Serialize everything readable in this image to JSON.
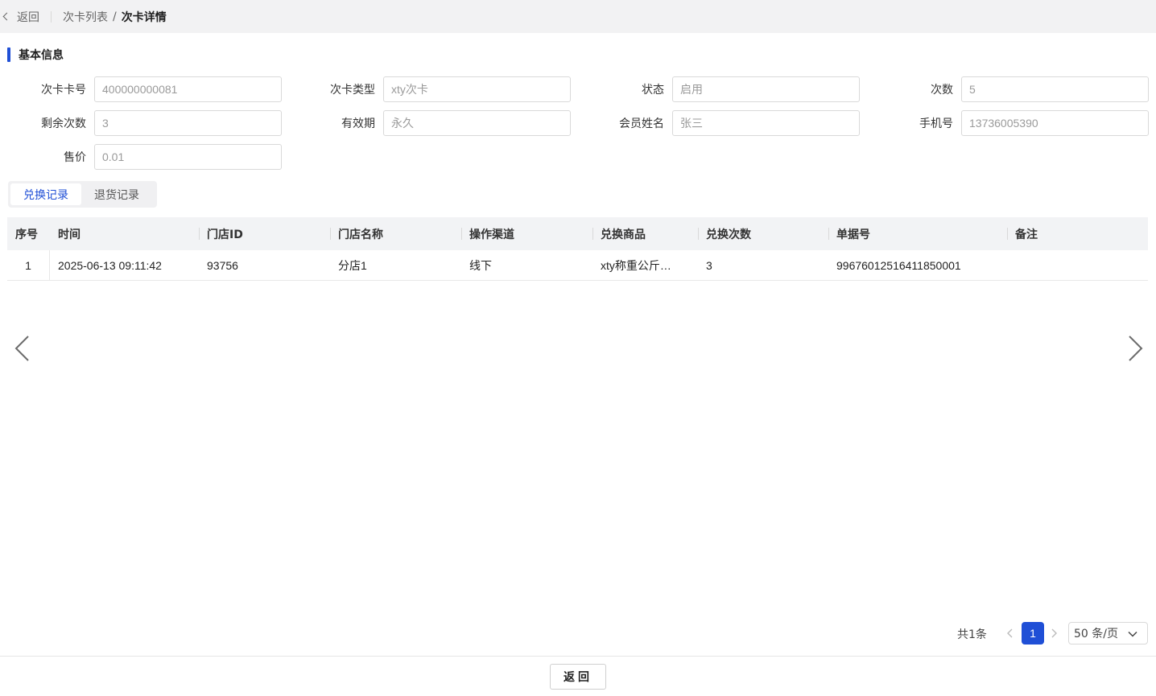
{
  "breadcrumb": {
    "back_label": "返回",
    "items": [
      "次卡列表",
      "次卡详情"
    ],
    "separator": "/"
  },
  "section": {
    "title": "基本信息"
  },
  "fields": [
    {
      "label": "次卡卡号",
      "value": "400000000081"
    },
    {
      "label": "次卡类型",
      "value": "xty次卡"
    },
    {
      "label": "状态",
      "value": "启用"
    },
    {
      "label": "次数",
      "value": "5"
    },
    {
      "label": "剩余次数",
      "value": "3"
    },
    {
      "label": "有效期",
      "value": "永久"
    },
    {
      "label": "会员姓名",
      "value": "张三"
    },
    {
      "label": "手机号",
      "value": "13736005390"
    },
    {
      "label": "售价",
      "value": "0.01"
    }
  ],
  "tabs": [
    {
      "label": "兑换记录",
      "active": true
    },
    {
      "label": "退货记录",
      "active": false
    }
  ],
  "table": {
    "columns": [
      "序号",
      "时间",
      "门店ID",
      "门店名称",
      "操作渠道",
      "兑换商品",
      "兑换次数",
      "单据号",
      "备注"
    ],
    "rows": [
      [
        "1",
        "2025-06-13 09:11:42",
        "93756",
        "分店1",
        "线下",
        "xty称重公斤…",
        "3",
        "99676012516411850001",
        ""
      ]
    ]
  },
  "pagination": {
    "total_label": "共1条",
    "current_page": "1",
    "page_size_label": "50 条/页"
  },
  "footer": {
    "back_button": "返回"
  },
  "colors": {
    "accent": "#1f4fd6",
    "topbar_bg": "#f2f2f3",
    "table_header_bg": "#f2f3f5"
  },
  "icons": {
    "back": "chevron-left-icon",
    "carousel_prev": "chevron-left-icon",
    "carousel_next": "chevron-right-icon",
    "dropdown": "chevron-down-icon"
  }
}
